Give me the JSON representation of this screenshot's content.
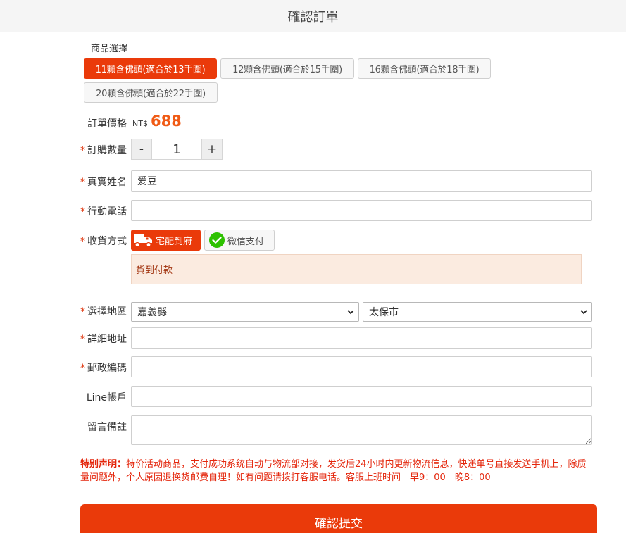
{
  "header": {
    "title": "確認訂單"
  },
  "product": {
    "label": "商品選擇",
    "options": [
      {
        "label": "11顆含佛頭(適合於13手圍)",
        "selected": true
      },
      {
        "label": "12顆含佛頭(適合於15手圍)",
        "selected": false
      },
      {
        "label": "16顆含佛頭(適合於18手圍)",
        "selected": false
      },
      {
        "label": "20顆含佛頭(適合於22手圍)",
        "selected": false
      }
    ]
  },
  "price": {
    "label": "訂單價格",
    "currency": "NT$",
    "value": "688"
  },
  "quantity": {
    "label": "訂購數量",
    "minus": "-",
    "value": "1",
    "plus": "+"
  },
  "name": {
    "label": "真實姓名",
    "value": "爱豆"
  },
  "phone": {
    "label": "行動電話",
    "value": ""
  },
  "shipping": {
    "label": "收貨方式",
    "options": [
      {
        "label": "宅配到府",
        "icon": "truck-icon",
        "selected": true
      },
      {
        "label": "微信支付",
        "icon": "wechat-icon",
        "selected": false
      }
    ],
    "payment_note": "貨到付款"
  },
  "region": {
    "label": "選擇地區",
    "county": "嘉義縣",
    "city": "太保市"
  },
  "address": {
    "label": "詳細地址",
    "value": ""
  },
  "postal": {
    "label": "郵政編碼",
    "value": ""
  },
  "line": {
    "label": "Line帳戶",
    "value": ""
  },
  "remark": {
    "label": "留言備註",
    "value": ""
  },
  "notice": {
    "title": "特别声明：",
    "text": "特价活动商品，支付成功系统自动与物流部对接，发货后24小时内更新物流信息，快递单号直接发送手机上，除质量问题外，个人原因退换货邮费自理！如有问题请拨打客服电话。客服上班时间　早9：00　晚8：00"
  },
  "submit": {
    "label": "確認提交"
  },
  "colors": {
    "accent": "#ea3a0a",
    "price": "#f05a14",
    "wechat": "#2dc100",
    "notice": "#e4260c"
  }
}
